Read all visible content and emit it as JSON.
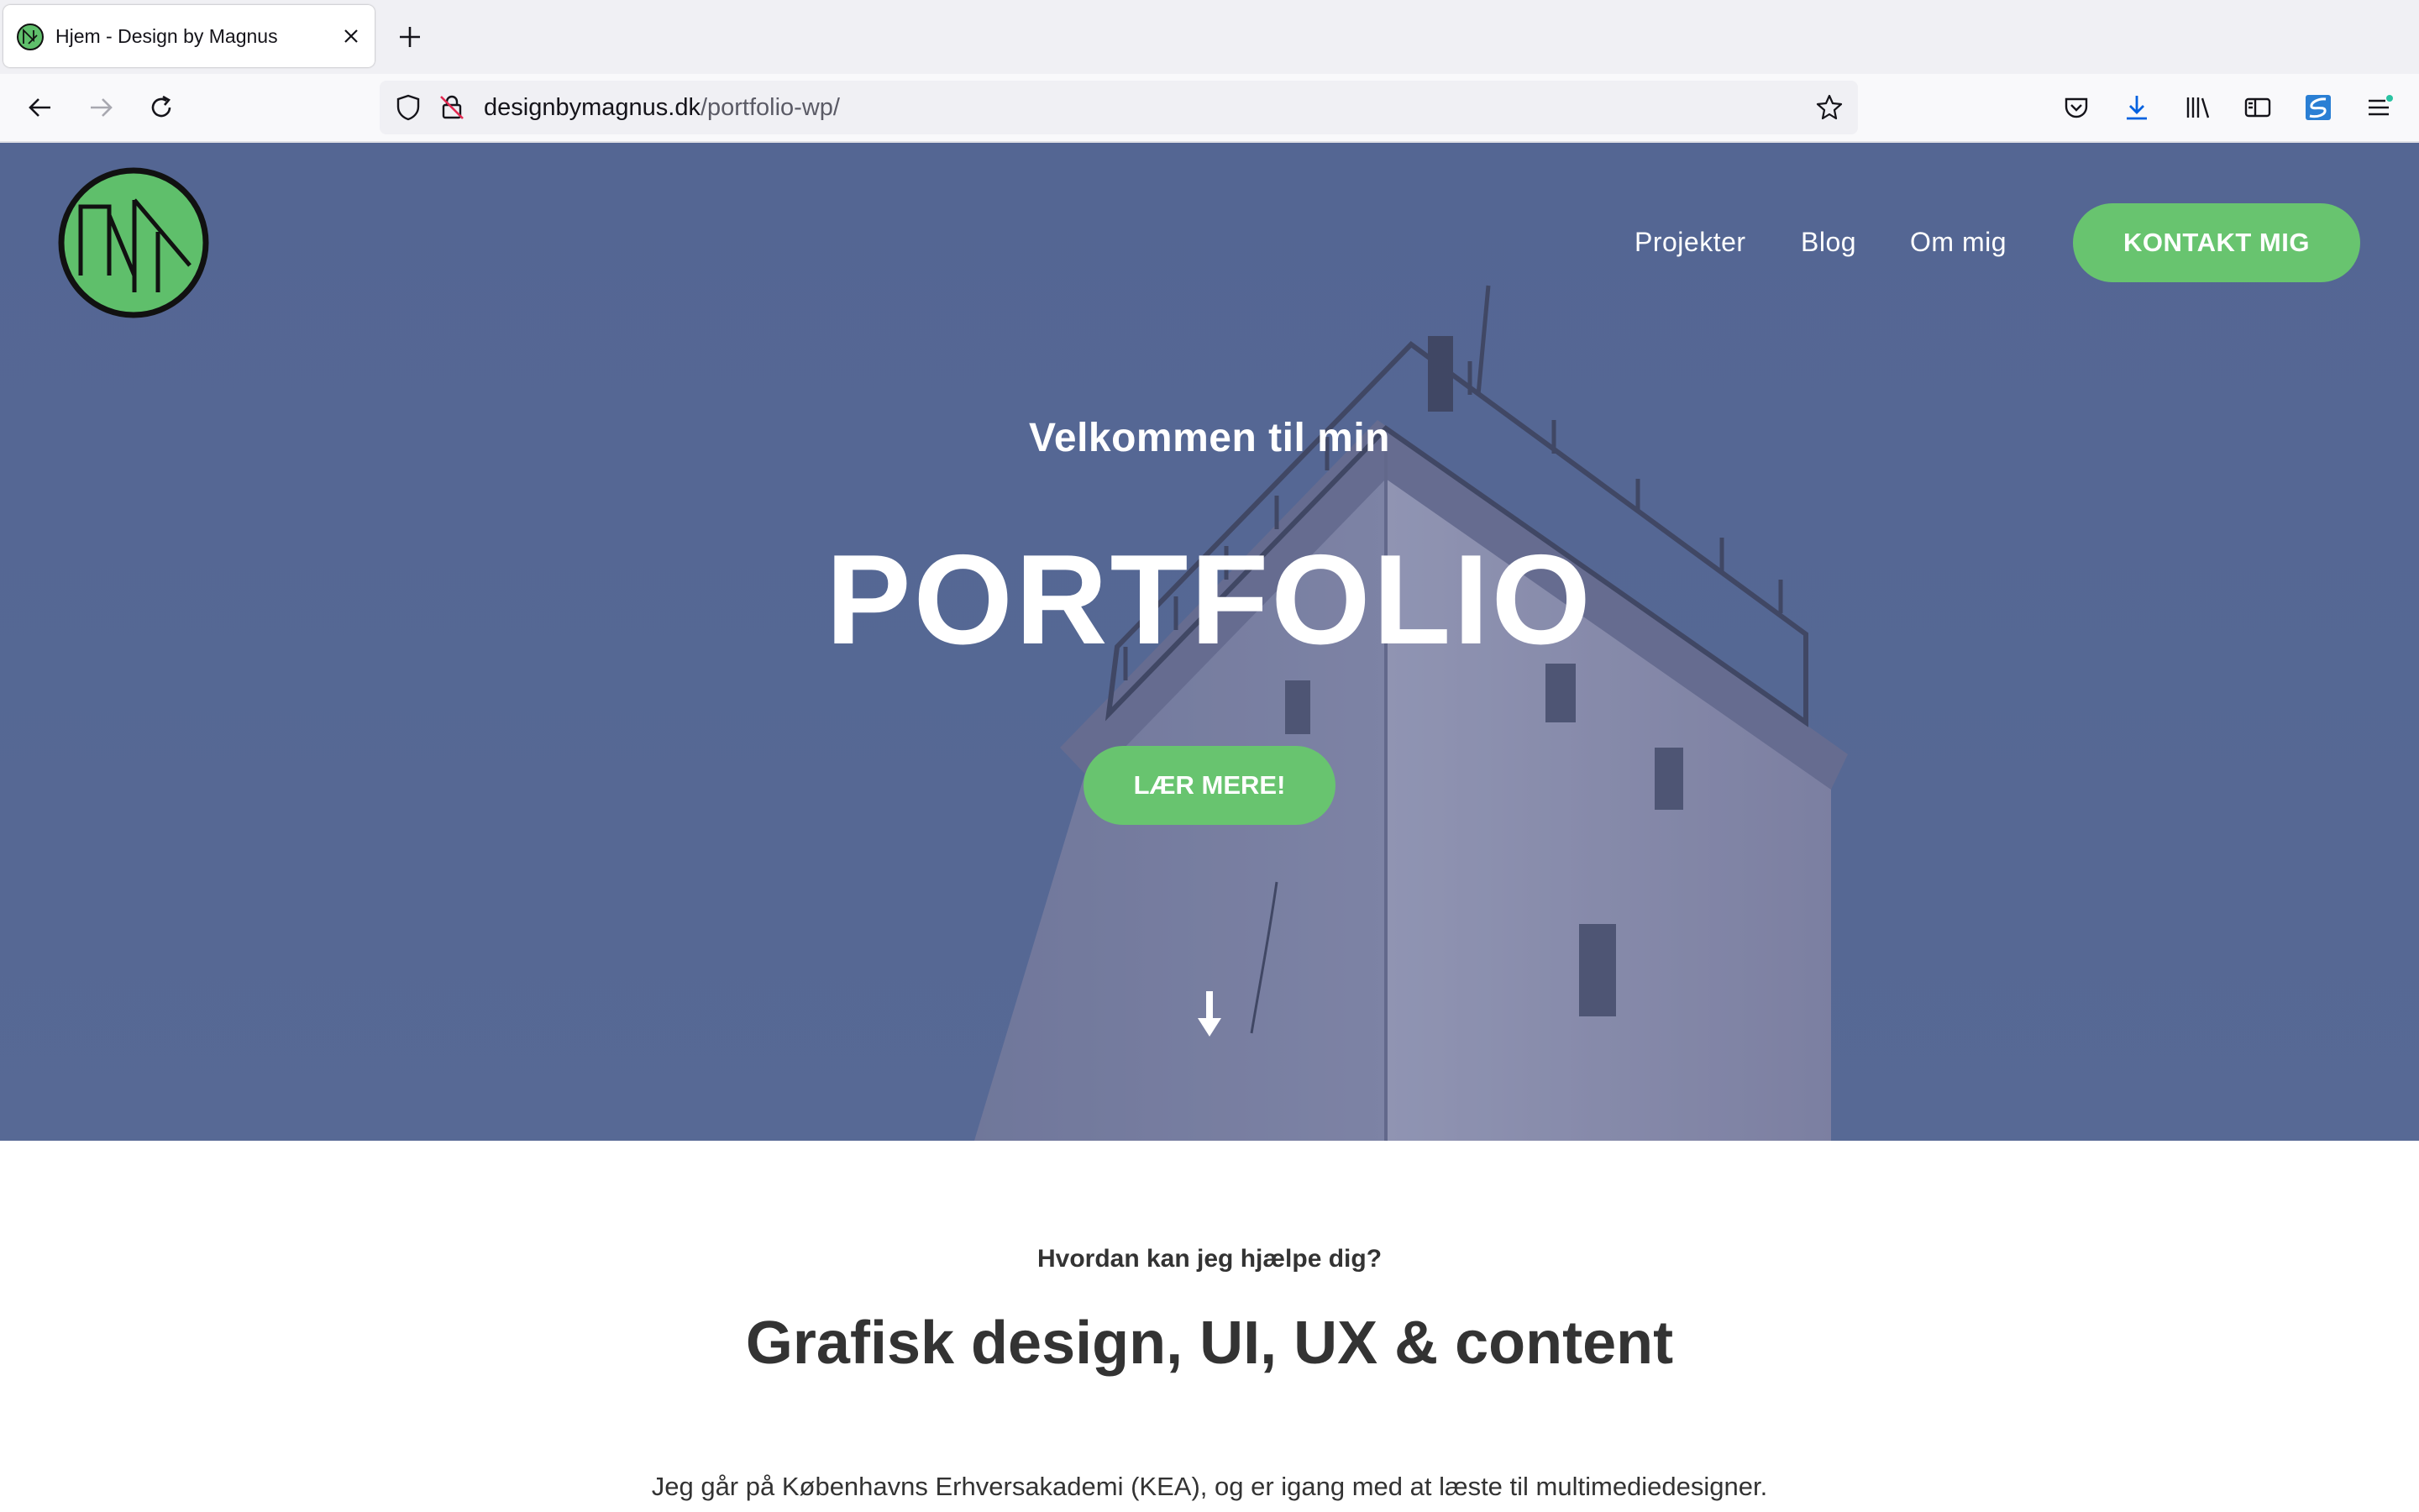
{
  "browser": {
    "tab_title": "Hjem - Design by Magnus",
    "url_domain": "designbymagnus.dk",
    "url_path": "/portfolio-wp/"
  },
  "site": {
    "nav": [
      "Projekter",
      "Blog",
      "Om mig"
    ],
    "contact_button": "KONTAKT MIG",
    "accent_color": "#68c46f"
  },
  "hero": {
    "welcome": "Velkommen til min",
    "title": "PORTFOLIO",
    "cta": "LÆR MERE!"
  },
  "section": {
    "eyebrow": "Hvordan kan jeg hjælpe dig?",
    "headline": "Grafisk design, UI, UX & content",
    "intro": "Jeg går på Københavns Erhversakademi (KEA), og er igang med at læste til multimediedesigner."
  }
}
